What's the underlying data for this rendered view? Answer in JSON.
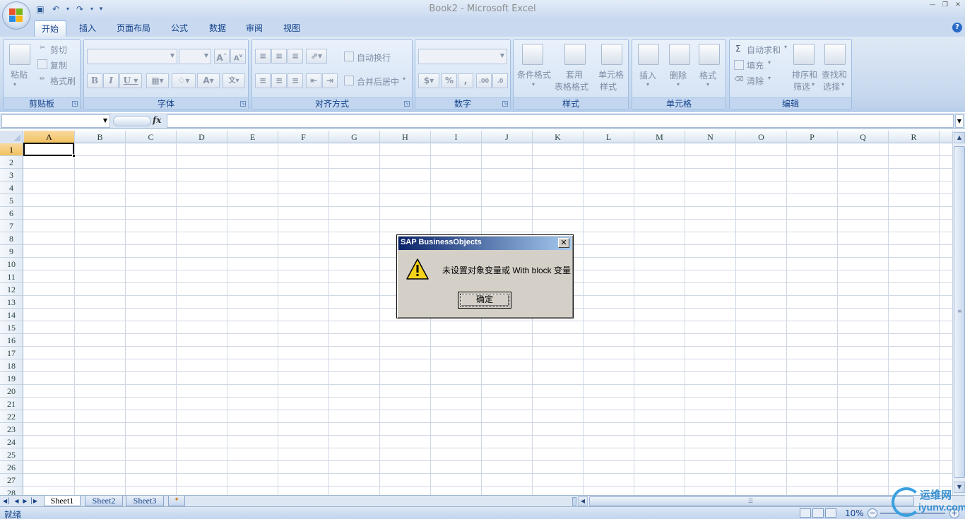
{
  "window": {
    "title": "Book2 - Microsoft Excel"
  },
  "tabs": [
    "开始",
    "插入",
    "页面布局",
    "公式",
    "数据",
    "审阅",
    "视图"
  ],
  "ribbon": {
    "clipboard": {
      "label": "剪贴板",
      "paste": "粘贴",
      "cut": "剪切",
      "copy": "复制",
      "format_painter": "格式刷"
    },
    "font": {
      "label": "字体"
    },
    "alignment": {
      "label": "对齐方式",
      "wrap_text": "自动换行",
      "merge_center": "合并后居中"
    },
    "number": {
      "label": "数字"
    },
    "styles": {
      "label": "样式",
      "conditional": "条件格式",
      "table_format_1": "套用",
      "table_format_2": "表格格式",
      "cell_styles_1": "单元格",
      "cell_styles_2": "样式"
    },
    "cells": {
      "label": "单元格",
      "insert": "插入",
      "delete": "删除",
      "format": "格式"
    },
    "editing": {
      "label": "编辑",
      "autosum": "自动求和",
      "fill": "填充",
      "clear": "清除",
      "sort_1": "排序和",
      "sort_2": "筛选",
      "find_1": "查找和",
      "find_2": "选择"
    }
  },
  "formula_bar": {
    "fx": "fx",
    "name_box": "",
    "formula": ""
  },
  "columns": [
    "A",
    "B",
    "C",
    "D",
    "E",
    "F",
    "G",
    "H",
    "I",
    "J",
    "K",
    "L",
    "M",
    "N",
    "O",
    "P",
    "Q",
    "R"
  ],
  "rows": [
    "1",
    "2",
    "3",
    "4",
    "5",
    "6",
    "7",
    "8",
    "9",
    "10",
    "11",
    "12",
    "13",
    "14",
    "15",
    "16",
    "17",
    "18",
    "19",
    "20",
    "21",
    "22",
    "23",
    "24",
    "25",
    "26",
    "27",
    "28"
  ],
  "sheets": [
    "Sheet1",
    "Sheet2",
    "Sheet3"
  ],
  "status": {
    "text": "就绪",
    "zoom": "10%"
  },
  "dialog": {
    "title": "SAP BusinessObjects",
    "message": "未设置对象变量或 With block 变量",
    "ok": "确定"
  },
  "watermark": {
    "line1": "运维网",
    "line2": "iyunv.com"
  }
}
